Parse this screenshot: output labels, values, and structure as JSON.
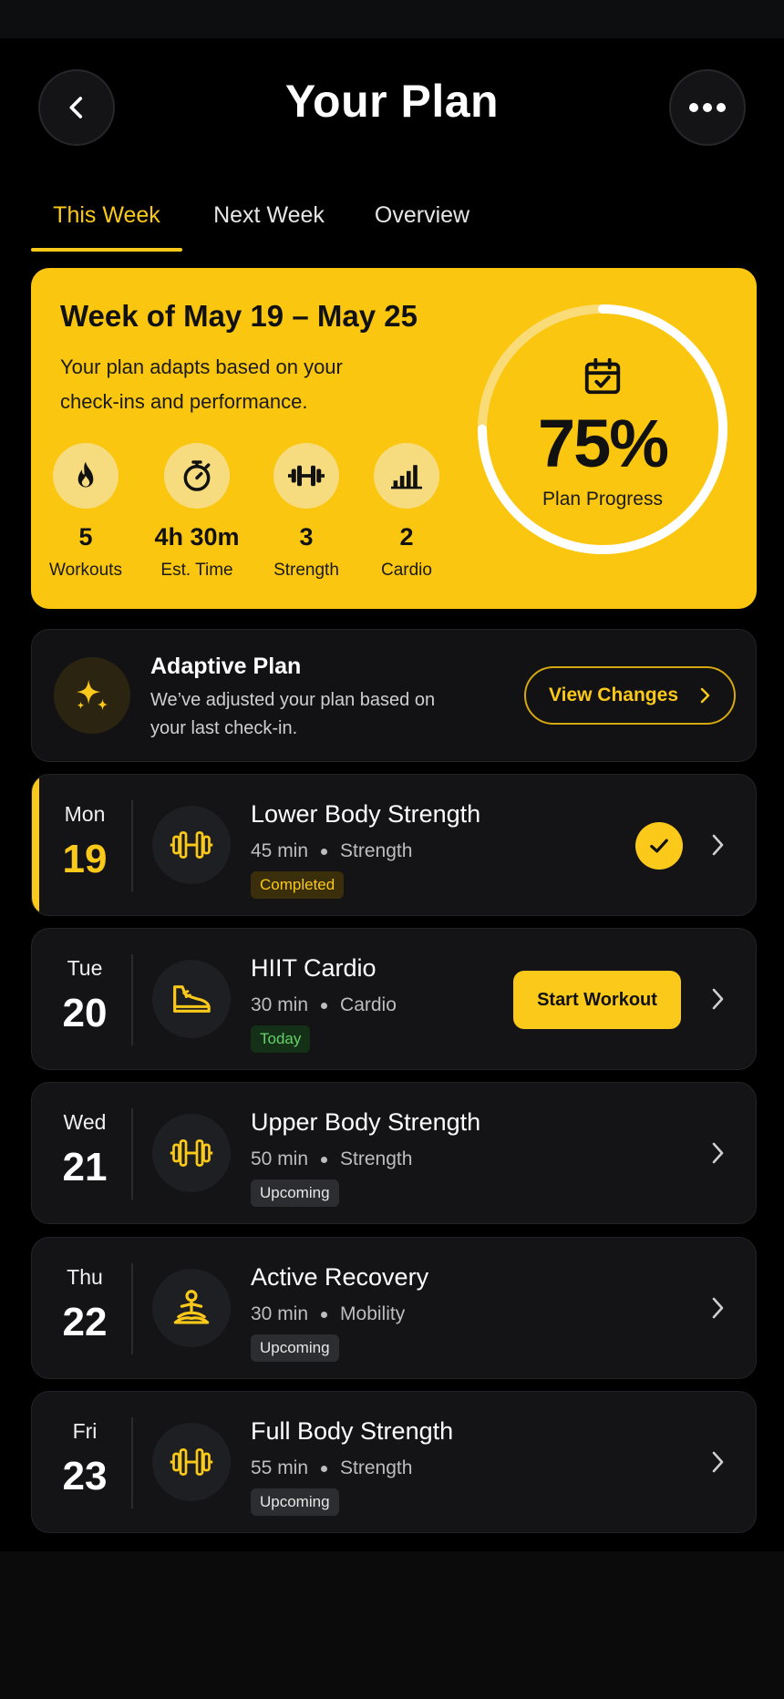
{
  "header": {
    "title": "Your Plan",
    "back_icon": "chevron-left-icon",
    "more_icon": "more-horizontal-icon"
  },
  "tabs": [
    {
      "label": "This Week",
      "active": true
    },
    {
      "label": "Next Week",
      "active": false
    },
    {
      "label": "Overview",
      "active": false
    }
  ],
  "week_summary": {
    "title": "Week of May 19 – May 25",
    "subtitle": "Your plan adapts based on your check-ins and performance.",
    "stats": [
      {
        "icon": "flame-icon",
        "value": "5",
        "label": "Workouts"
      },
      {
        "icon": "stopwatch-icon",
        "value": "4h 30m",
        "label": "Est. Time"
      },
      {
        "icon": "dumbbell-icon",
        "value": "3",
        "label": "Strength"
      },
      {
        "icon": "bar-chart-icon",
        "value": "2",
        "label": "Cardio"
      }
    ],
    "progress": {
      "value": "75%",
      "fraction": 0.75,
      "label": "Plan Progress",
      "icon": "calendar-check-icon"
    }
  },
  "adaptive": {
    "title": "Adaptive Plan",
    "text": "We’ve adjusted your plan based on your last check-in.",
    "button_label": "View Changes",
    "icon": "sparkle-icon"
  },
  "days": [
    {
      "day": "Mon",
      "date": "19",
      "title": "Lower Body Strength",
      "duration": "45 min",
      "type": "Strength",
      "status": "Completed",
      "icon": "dumbbell-icon"
    },
    {
      "day": "Tue",
      "date": "20",
      "title": "HIIT Cardio",
      "duration": "30 min",
      "type": "Cardio",
      "status": "Today",
      "icon": "sneaker-icon",
      "action_label": "Start Workout"
    },
    {
      "day": "Wed",
      "date": "21",
      "title": "Upper Body Strength",
      "duration": "50 min",
      "type": "Strength",
      "status": "Upcoming",
      "icon": "dumbbell-icon"
    },
    {
      "day": "Thu",
      "date": "22",
      "title": "Active Recovery",
      "duration": "30 min",
      "type": "Mobility",
      "status": "Upcoming",
      "icon": "meditation-icon"
    },
    {
      "day": "Fri",
      "date": "23",
      "title": "Full Body Strength",
      "duration": "55 min",
      "type": "Strength",
      "status": "Upcoming",
      "icon": "dumbbell-icon"
    }
  ],
  "colors": {
    "accent": "#fbc91a",
    "card": "#141416",
    "background": "#000000",
    "today_green": "#66d16a"
  }
}
